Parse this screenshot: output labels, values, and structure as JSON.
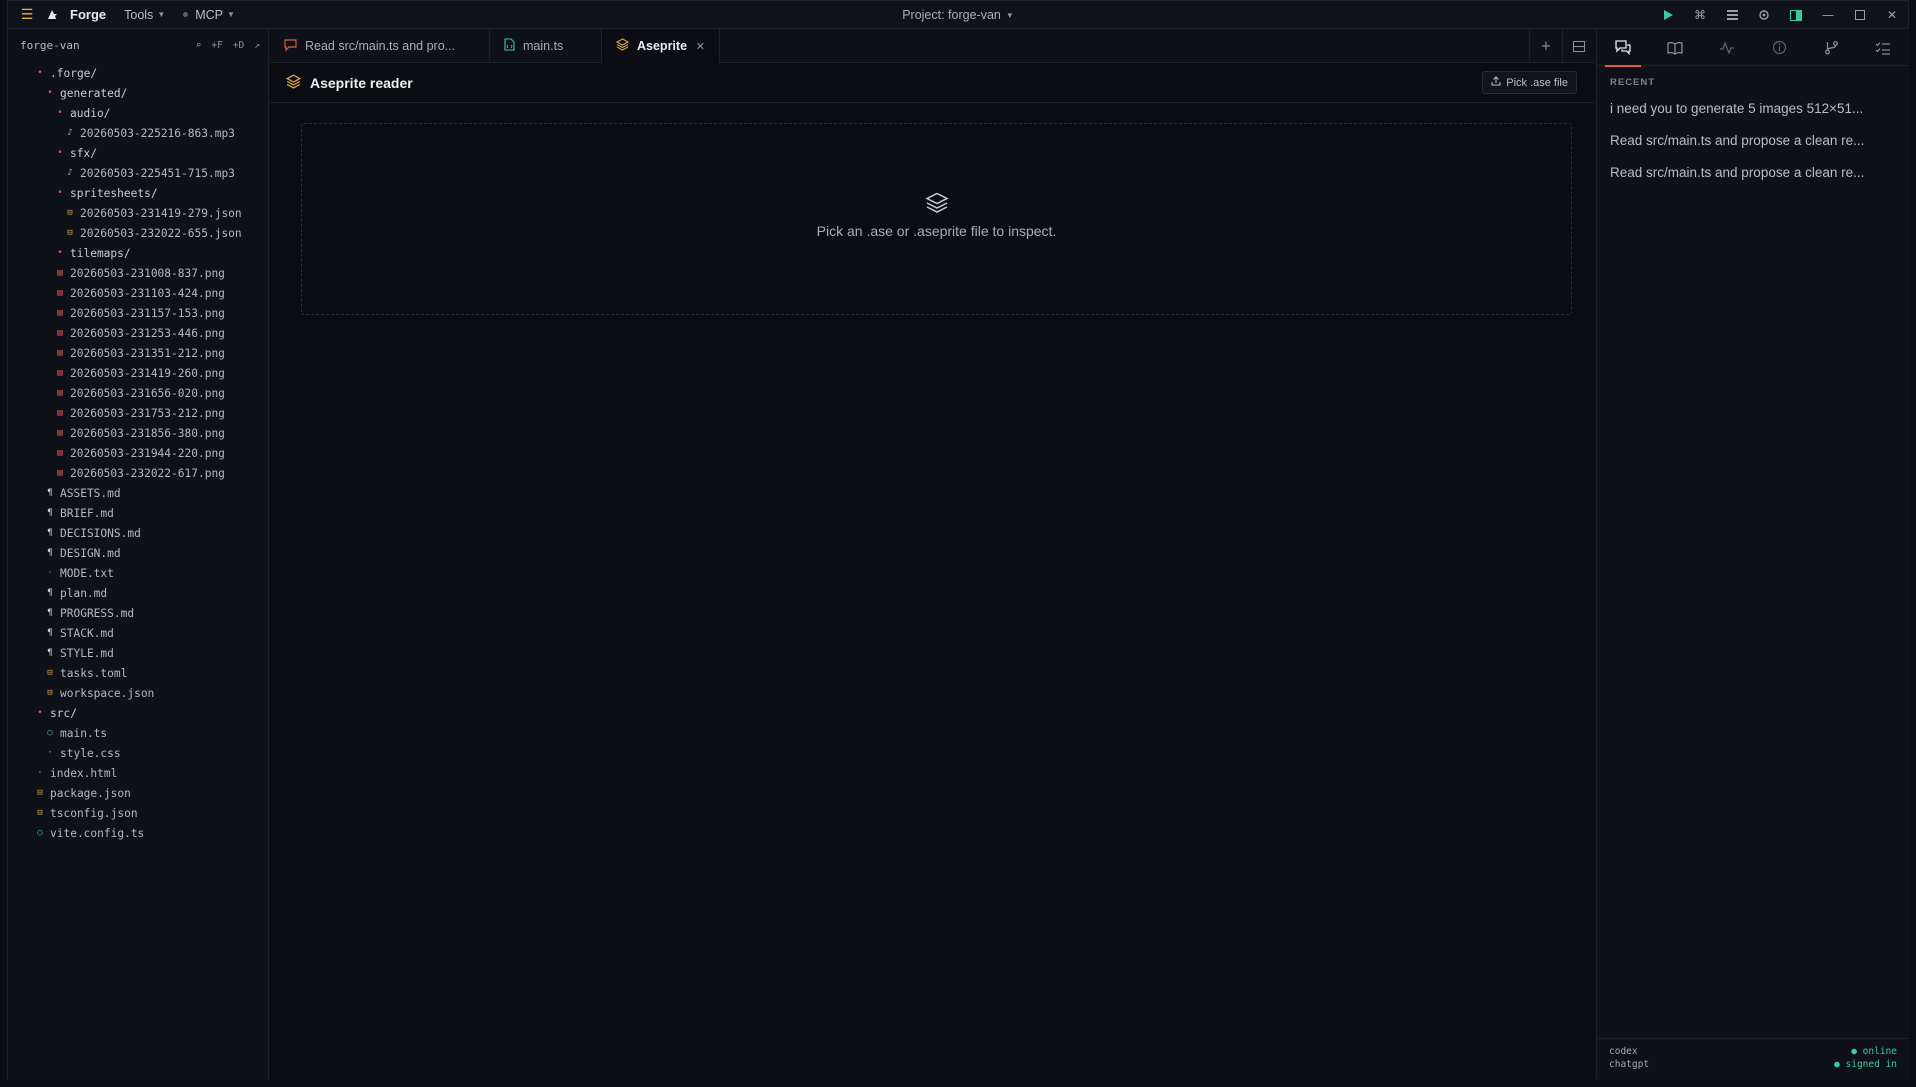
{
  "titlebar": {
    "app_name": "Forge",
    "tools_label": "Tools",
    "mcp_label": "MCP",
    "project_label": "Project: forge-van"
  },
  "sidebar": {
    "title": "forge-van",
    "actions": [
      "⌕",
      "+F",
      "+D",
      "↗"
    ],
    "tree": [
      {
        "name": ".forge/",
        "type": "folder",
        "depth": 0
      },
      {
        "name": "generated/",
        "type": "folder",
        "depth": 1
      },
      {
        "name": "audio/",
        "type": "folder",
        "depth": 2
      },
      {
        "name": "20260503-225216-863.mp3",
        "type": "audio",
        "depth": 3
      },
      {
        "name": "sfx/",
        "type": "folder",
        "depth": 2
      },
      {
        "name": "20260503-225451-715.mp3",
        "type": "audio",
        "depth": 3
      },
      {
        "name": "spritesheets/",
        "type": "folder",
        "depth": 2
      },
      {
        "name": "20260503-231419-279.json",
        "type": "json",
        "depth": 3
      },
      {
        "name": "20260503-232022-655.json",
        "type": "json",
        "depth": 3
      },
      {
        "name": "tilemaps/",
        "type": "folder",
        "depth": 2
      },
      {
        "name": "20260503-231008-837.png",
        "type": "png",
        "depth": 2
      },
      {
        "name": "20260503-231103-424.png",
        "type": "png",
        "depth": 2
      },
      {
        "name": "20260503-231157-153.png",
        "type": "png",
        "depth": 2
      },
      {
        "name": "20260503-231253-446.png",
        "type": "png",
        "depth": 2
      },
      {
        "name": "20260503-231351-212.png",
        "type": "png",
        "depth": 2
      },
      {
        "name": "20260503-231419-260.png",
        "type": "png",
        "depth": 2
      },
      {
        "name": "20260503-231656-020.png",
        "type": "png",
        "depth": 2
      },
      {
        "name": "20260503-231753-212.png",
        "type": "png",
        "depth": 2
      },
      {
        "name": "20260503-231856-380.png",
        "type": "png",
        "depth": 2
      },
      {
        "name": "20260503-231944-220.png",
        "type": "png",
        "depth": 2
      },
      {
        "name": "20260503-232022-617.png",
        "type": "png",
        "depth": 2
      },
      {
        "name": "ASSETS.md",
        "type": "md",
        "depth": 1
      },
      {
        "name": "BRIEF.md",
        "type": "md",
        "depth": 1
      },
      {
        "name": "DECISIONS.md",
        "type": "md",
        "depth": 1
      },
      {
        "name": "DESIGN.md",
        "type": "md",
        "depth": 1
      },
      {
        "name": "MODE.txt",
        "type": "txt",
        "depth": 1
      },
      {
        "name": "plan.md",
        "type": "md",
        "depth": 1
      },
      {
        "name": "PROGRESS.md",
        "type": "md",
        "depth": 1
      },
      {
        "name": "STACK.md",
        "type": "md",
        "depth": 1
      },
      {
        "name": "STYLE.md",
        "type": "md",
        "depth": 1
      },
      {
        "name": "tasks.toml",
        "type": "json",
        "depth": 1
      },
      {
        "name": "workspace.json",
        "type": "json",
        "depth": 1
      },
      {
        "name": "src/",
        "type": "folder",
        "depth": 0
      },
      {
        "name": "main.ts",
        "type": "ts",
        "depth": 1
      },
      {
        "name": "style.css",
        "type": "css",
        "depth": 1
      },
      {
        "name": "index.html",
        "type": "html",
        "depth": 0
      },
      {
        "name": "package.json",
        "type": "json",
        "depth": 0
      },
      {
        "name": "tsconfig.json",
        "type": "json",
        "depth": 0
      },
      {
        "name": "vite.config.ts",
        "type": "ts",
        "depth": 0
      }
    ]
  },
  "tabs": [
    {
      "label": "Read src/main.ts and pro...",
      "icon": "chat-icon"
    },
    {
      "label": "main.ts",
      "icon": "file-code-icon"
    },
    {
      "label": "Aseprite",
      "icon": "layers-icon",
      "active": true
    }
  ],
  "panel": {
    "title": "Aseprite reader",
    "pick_button": "Pick .ase file",
    "empty_text": "Pick an .ase or .aseprite file to inspect."
  },
  "right_panel": {
    "recent_label": "RECENT",
    "recent_items": [
      "i need you to generate 5 images 512×51...",
      "Read src/main.ts and propose a clean re...",
      "Read src/main.ts and propose a clean re..."
    ],
    "footer": [
      {
        "name": "codex",
        "status": "● online"
      },
      {
        "name": "chatgpt",
        "status": "● signed in"
      }
    ]
  },
  "colors": {
    "accent": "#e05a4b",
    "teal": "#3ec7a4",
    "folder": "#e05a4b",
    "json": "#d9a24a",
    "background": "#0b0d12"
  }
}
